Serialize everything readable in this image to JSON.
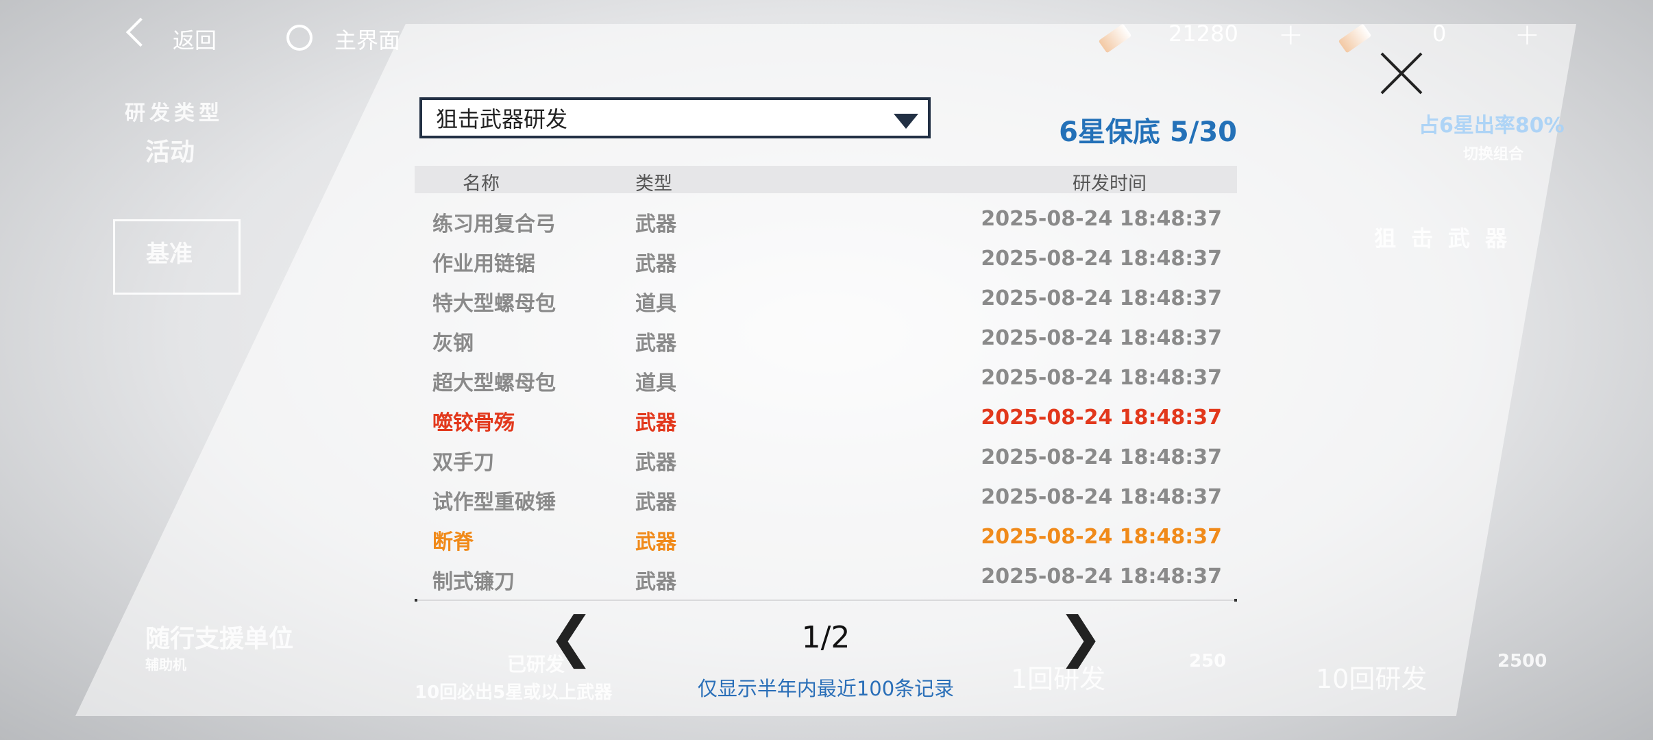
{
  "topbar": {
    "back_label": "返回",
    "home_label": "主界面",
    "currency1_value": "21280",
    "currency2_value": "0",
    "plus_label": "+"
  },
  "background": {
    "category_title": "研发类型",
    "category_active": "活动",
    "category_standard": "基准",
    "support_label": "随行支援单位",
    "support_sub": "辅助机",
    "rate_label": "占6星出率80%",
    "switch_label": "切换组合",
    "weapon_label": "狙击武器",
    "pity_hint": "已研发",
    "ten_hint": "10回必出5星或以上武器",
    "pull1_label": "1回研发",
    "pull10_label": "10回研发",
    "pull1_cost": "250",
    "pull10_cost": "2500"
  },
  "modal": {
    "dropdown_selected": "狙击武器研发",
    "guarantee": "6星保底 5/30",
    "columns": {
      "name": "名称",
      "type": "类型",
      "time": "研发时间"
    },
    "rows": [
      {
        "name": "练习用复合弓",
        "type": "武器",
        "time": "2025-08-24 18:48:37",
        "rarity": "normal"
      },
      {
        "name": "作业用链锯",
        "type": "武器",
        "time": "2025-08-24 18:48:37",
        "rarity": "normal"
      },
      {
        "name": "特大型螺母包",
        "type": "道具",
        "time": "2025-08-24 18:48:37",
        "rarity": "normal"
      },
      {
        "name": "灰钢",
        "type": "武器",
        "time": "2025-08-24 18:48:37",
        "rarity": "normal"
      },
      {
        "name": "超大型螺母包",
        "type": "道具",
        "time": "2025-08-24 18:48:37",
        "rarity": "normal"
      },
      {
        "name": "噬铰骨殇",
        "type": "武器",
        "time": "2025-08-24 18:48:37",
        "rarity": "red"
      },
      {
        "name": "双手刀",
        "type": "武器",
        "time": "2025-08-24 18:48:37",
        "rarity": "normal"
      },
      {
        "name": "试作型重破锤",
        "type": "武器",
        "time": "2025-08-24 18:48:37",
        "rarity": "normal"
      },
      {
        "name": "断脊",
        "type": "武器",
        "time": "2025-08-24 18:48:37",
        "rarity": "orange"
      },
      {
        "name": "制式镰刀",
        "type": "武器",
        "time": "2025-08-24 18:48:37",
        "rarity": "normal"
      }
    ],
    "page": "1/2",
    "prev_glyph": "❮",
    "next_glyph": "❯",
    "note": "仅显示半年内最近100条记录"
  },
  "colors": {
    "accent_blue": "#2471b8",
    "red": "#e2381c",
    "orange": "#f08a1a"
  }
}
